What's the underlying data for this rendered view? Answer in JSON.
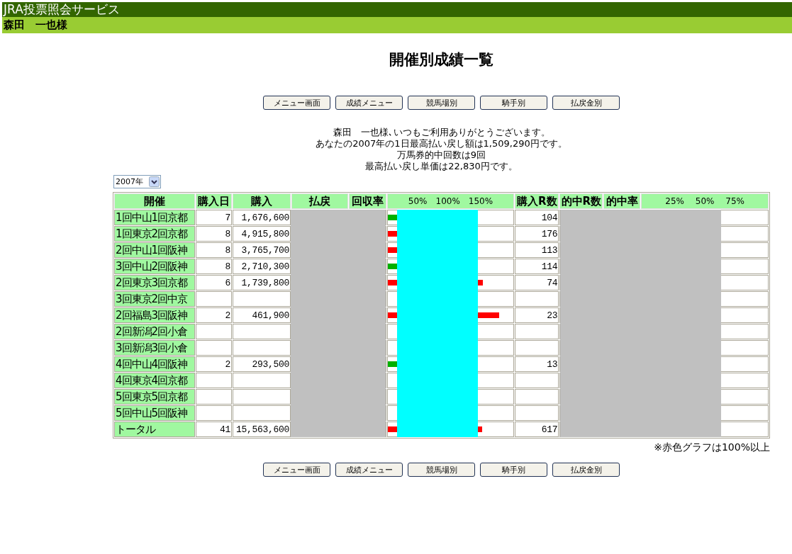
{
  "header": {
    "service_title": "JRA投票照会サービス",
    "user_name": "森田　一也様"
  },
  "page_title": "開催別成績一覧",
  "nav_buttons_top": [
    "メニュー画面",
    "成績メニュー",
    "競馬場別",
    "騎手別",
    "払戻金別"
  ],
  "messages": [
    "森田　一也様､いつもご利用ありがとうございます。",
    "あなたの2007年の1日最高払い戻し額は1,509,290円です。",
    "万馬券的中回数は9回",
    "最高払い戻し単価は22,830円です。"
  ],
  "year_select": {
    "value": "2007年"
  },
  "table": {
    "columns": [
      "開催",
      "購入日",
      "購入",
      "払戻",
      "回収率",
      "50%　100%　150%",
      "購入R数",
      "的中R数",
      "的中率",
      "25%　 50%　 75%"
    ],
    "rows": [
      {
        "meeting": "1回中山1回京都",
        "days": "7",
        "purchase": "1,676,600",
        "rate_bar": {
          "level": 0.3,
          "color": "#00b000"
        },
        "races": "104"
      },
      {
        "meeting": "1回東京2回京都",
        "days": "8",
        "purchase": "4,915,800",
        "rate_bar": {
          "level": 0.6,
          "color": "#ff0000"
        },
        "races": "176"
      },
      {
        "meeting": "2回中山1回阪神",
        "days": "8",
        "purchase": "3,765,700",
        "rate_bar": {
          "level": 0.6,
          "color": "#ff0000"
        },
        "races": "113"
      },
      {
        "meeting": "3回中山2回阪神",
        "days": "8",
        "purchase": "2,710,300",
        "rate_bar": {
          "level": 0.3,
          "color": "#00b000"
        },
        "races": "114"
      },
      {
        "meeting": "2回東京3回京都",
        "days": "6",
        "purchase": "1,739,800",
        "rate_bar": {
          "level": 0.755,
          "color": "#ff0000"
        },
        "races": "74"
      },
      {
        "meeting": "3回東京2回中京"
      },
      {
        "meeting": "2回福島3回阪神",
        "days": "2",
        "purchase": "461,900",
        "rate_bar": {
          "level": 0.885,
          "color": "#ff0000"
        },
        "races": "23"
      },
      {
        "meeting": "2回新潟2回小倉"
      },
      {
        "meeting": "3回新潟3回小倉"
      },
      {
        "meeting": "4回中山4回阪神",
        "days": "2",
        "purchase": "293,500",
        "rate_bar": {
          "level": 0.3,
          "color": "#00b000"
        },
        "races": "13"
      },
      {
        "meeting": "4回東京4回京都"
      },
      {
        "meeting": "5回東京5回京都"
      },
      {
        "meeting": "5回中山5回阪神"
      },
      {
        "meeting": "トータル",
        "days": "41",
        "purchase": "15,563,600",
        "rate_bar": {
          "level": 0.75,
          "color": "#ff0000"
        },
        "races": "617"
      }
    ]
  },
  "note": "※赤色グラフは100%以上",
  "nav_buttons_bottom": [
    "メニュー画面",
    "成績メニュー",
    "競馬場別",
    "騎手別",
    "払戻金別"
  ]
}
